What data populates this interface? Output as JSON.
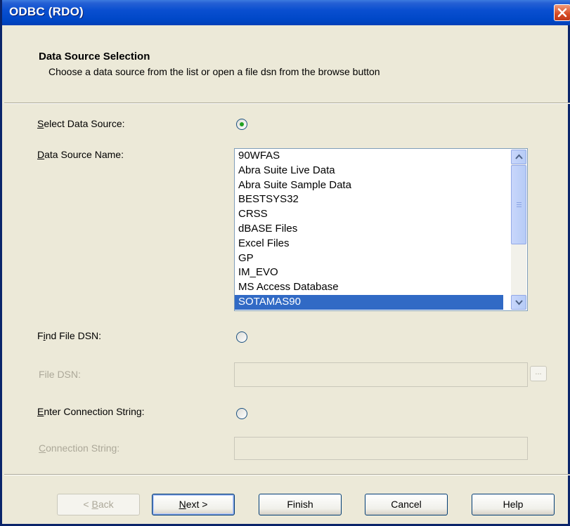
{
  "window": {
    "title": "ODBC (RDO)"
  },
  "header": {
    "title": "Data Source Selection",
    "subtitle": "Choose a data source from the list or open a file dsn from the browse button"
  },
  "select_data_source": {
    "prefix": "S",
    "rest": "elect Data Source:",
    "selected": true
  },
  "data_source_name": {
    "prefix": "D",
    "rest": "ata Source Name:",
    "items": [
      "90WFAS",
      "Abra Suite Live Data",
      "Abra Suite Sample Data",
      "BESTSYS32",
      "CRSS",
      "dBASE Files",
      "Excel Files",
      "GP",
      "IM_EVO",
      "MS Access Database",
      "SOTAMAS90"
    ],
    "selected": "SOTAMAS90"
  },
  "find_file_dsn": {
    "pre": "F",
    "mid": "i",
    "rest": "nd File DSN:",
    "selected": false
  },
  "file_dsn": {
    "label": "File DSN:",
    "value": "",
    "browse_label": "..."
  },
  "enter_connection_string": {
    "prefix": "E",
    "rest": "nter Connection String:",
    "selected": false
  },
  "connection_string": {
    "prefix": "C",
    "rest": "onnection String:",
    "value": ""
  },
  "buttons": {
    "back_pre": "< ",
    "back_u": "B",
    "back_rest": "ack",
    "next_u": "N",
    "next_rest": "ext >",
    "finish": "Finish",
    "cancel": "Cancel",
    "help": "Help"
  },
  "colors": {
    "selection": "#316ac5",
    "titlebar": "#0048c8",
    "dialog_bg": "#ece9d8"
  }
}
